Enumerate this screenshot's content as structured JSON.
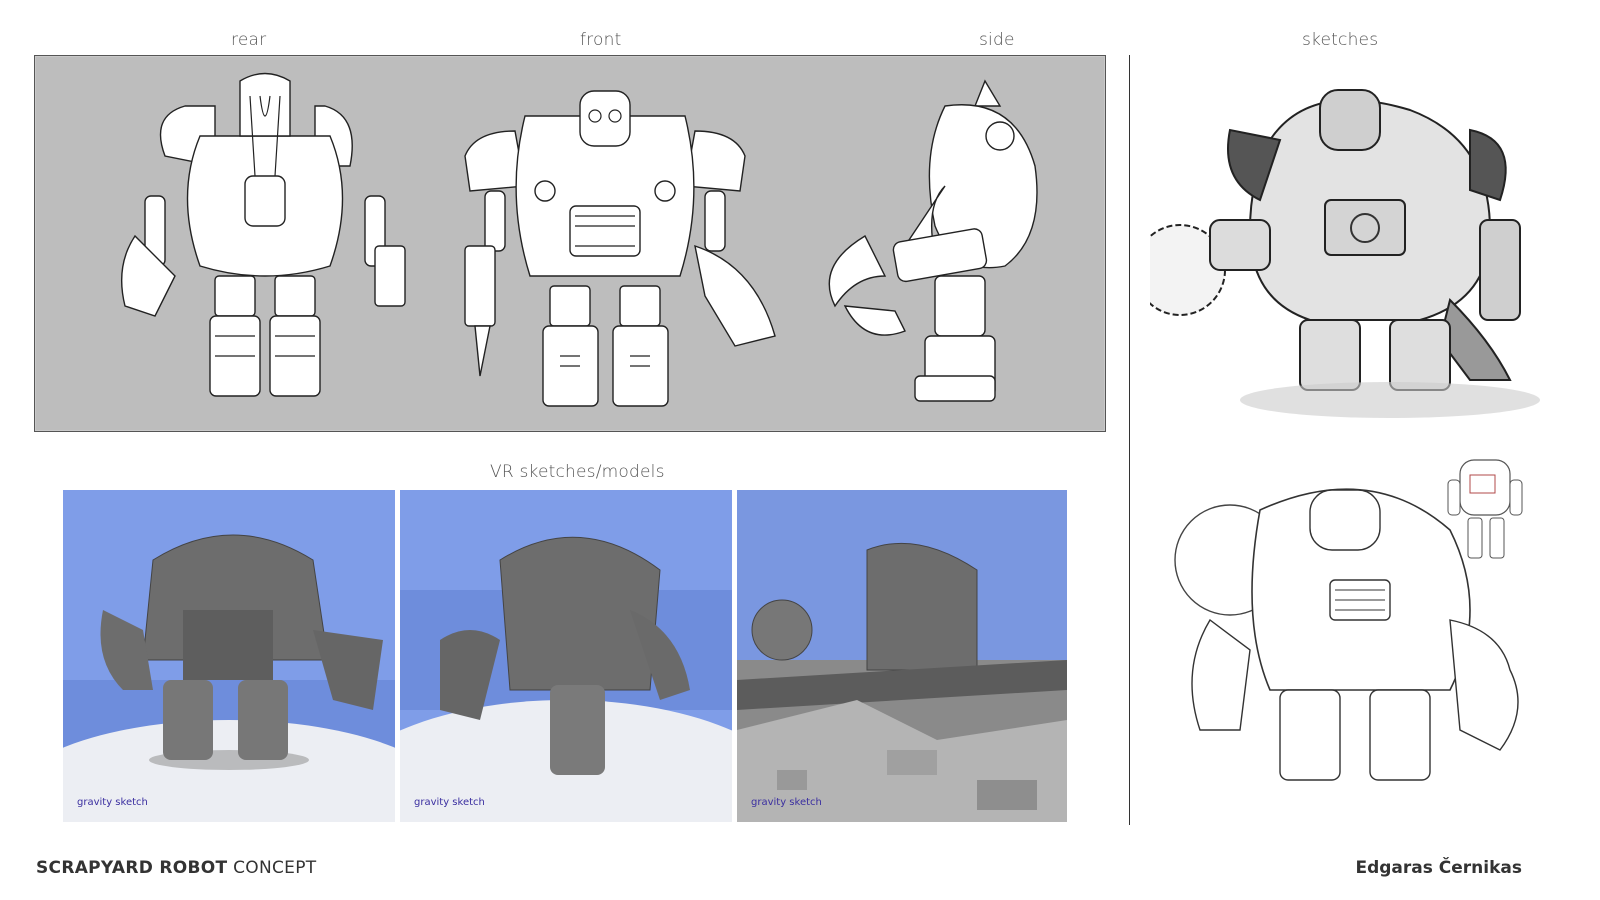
{
  "turnaround": {
    "labels": {
      "rear": "rear",
      "front": "front",
      "side": "side"
    }
  },
  "sketches": {
    "label": "sketches"
  },
  "vr": {
    "label": "VR sketches/models",
    "tiles": [
      {
        "watermark": "gravity sketch"
      },
      {
        "watermark": "gravity sketch"
      },
      {
        "watermark": "gravity sketch"
      }
    ]
  },
  "footer": {
    "title_bold": "SCRAPYARD ROBOT",
    "title_light": " CONCEPT",
    "author": "Edgaras Černikas"
  },
  "colors": {
    "panel_gray": "#bdbdbd",
    "vr_sky": "#7f9de8",
    "vr_ground": "#eceef3",
    "model_gray": "#6d6d6d"
  }
}
